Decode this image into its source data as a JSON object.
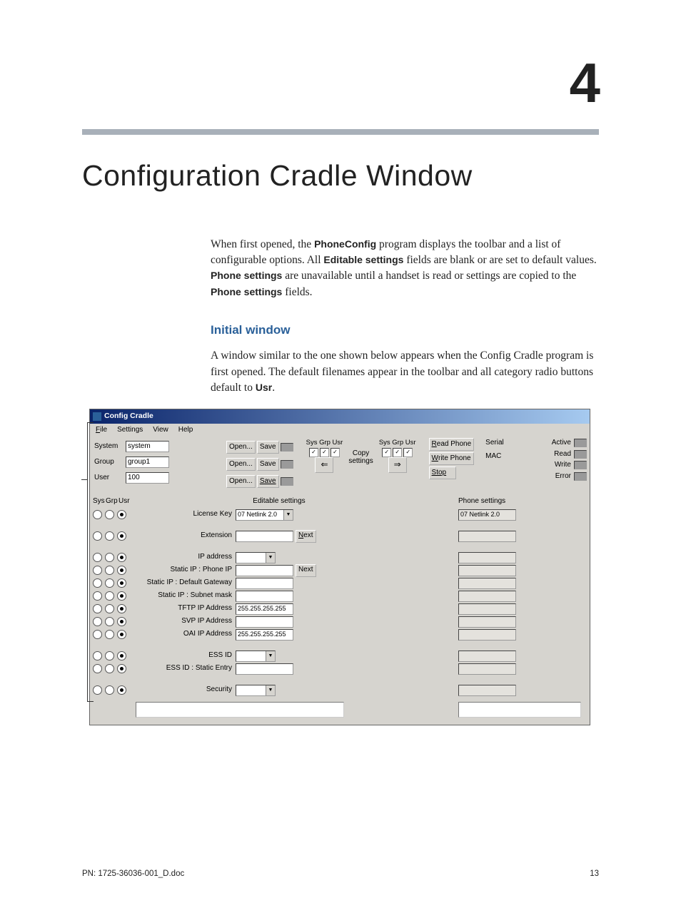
{
  "chapter_number": "4",
  "chapter_title": "Configuration Cradle Window",
  "intro": {
    "pre1": "When first opened, the ",
    "bold1": "PhoneConfig",
    "mid1": " program displays the toolbar and a list of configurable options. All ",
    "bold2": "Editable settings",
    "mid2": " fields are blank or are set to default values. ",
    "bold3": "Phone settings",
    "mid3": " are unavailable until a handset is read or settings are copied to the ",
    "bold4": "Phone settings",
    "post": " fields."
  },
  "section_title": "Initial window",
  "section_body": {
    "pre": "A window similar to the one shown below appears when the Config Cradle program is first opened. The default filenames appear in the toolbar and all category radio buttons default to ",
    "bold": "Usr",
    "post": "."
  },
  "app": {
    "title": "Config Cradle",
    "menu": {
      "file": "File",
      "settings": "Settings",
      "view": "View",
      "help": "Help"
    },
    "files": {
      "system_label": "System",
      "system_val": "system",
      "group_label": "Group",
      "group_val": "group1",
      "user_label": "User",
      "user_val": "100",
      "open": "Open...",
      "save": "Save"
    },
    "copy": {
      "head": "Sys Grp Usr",
      "label_top": "Copy",
      "label_bot": "settings"
    },
    "phone_btns": {
      "read": "Read Phone",
      "write": "Write Phone",
      "stop": "Stop"
    },
    "serial": {
      "serial_label": "Serial",
      "mac_label": "MAC"
    },
    "status": {
      "active": "Active",
      "read": "Read",
      "write": "Write",
      "error": "Error"
    },
    "radio_head": {
      "sys": "Sys",
      "grp": "Grp",
      "usr": "Usr"
    },
    "editable_head": "Editable settings",
    "phone_head": "Phone settings",
    "rows": {
      "license": {
        "label": "License Key",
        "value": "07 Netlink 2.0",
        "phone_value": "07 Netlink 2.0"
      },
      "extension": {
        "label": "Extension",
        "value": "",
        "next": "Next"
      },
      "ip_address": {
        "label": "IP address",
        "value": ""
      },
      "phone_ip": {
        "label": "Static IP : Phone IP",
        "value": "",
        "next": "Next"
      },
      "gateway": {
        "label": "Static IP : Default Gateway",
        "value": ""
      },
      "subnet": {
        "label": "Static IP : Subnet mask",
        "value": ""
      },
      "tftp": {
        "label": "TFTP IP Address",
        "value": "255.255.255.255"
      },
      "svp": {
        "label": "SVP IP Address",
        "value": ""
      },
      "oai": {
        "label": "OAI IP Address",
        "value": "255.255.255.255"
      },
      "essid": {
        "label": "ESS ID",
        "value": ""
      },
      "ess_static": {
        "label": "ESS ID : Static Entry",
        "value": ""
      },
      "security": {
        "label": "Security",
        "value": ""
      }
    }
  },
  "footer": {
    "left": "PN: 1725-36036-001_D.doc",
    "right": "13"
  }
}
